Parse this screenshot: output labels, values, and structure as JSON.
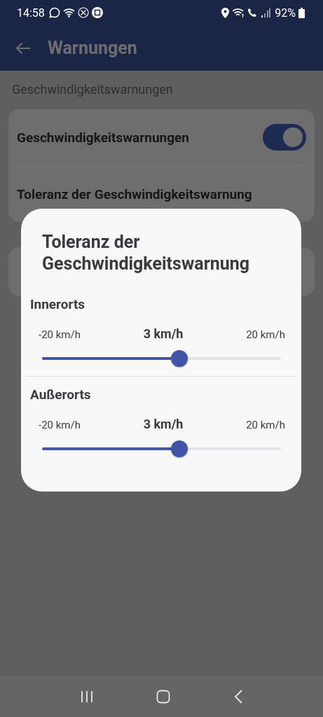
{
  "status_bar": {
    "time": "14:58",
    "battery": "92%"
  },
  "header": {
    "title": "Warnungen"
  },
  "section_title": "Geschwindigkeitswarnungen",
  "settings": [
    {
      "kind": "toggle",
      "label": "Geschwindigkeitswarnungen",
      "on": true
    },
    {
      "kind": "link",
      "label": "Toleranz der Geschwindigkeitswarnung"
    }
  ],
  "dialog": {
    "title": "Toleranz der Geschwindigkeitswarnung",
    "sliders": [
      {
        "label": "Innerorts",
        "min_label": "-20 km/h",
        "value": "3 km/h",
        "max_label": "20 km/h",
        "level": 0.575
      },
      {
        "label": "Außerorts",
        "min_label": "-20 km/h",
        "value": "3 km/h",
        "max_label": "20 km/h",
        "level": 0.575
      }
    ]
  }
}
